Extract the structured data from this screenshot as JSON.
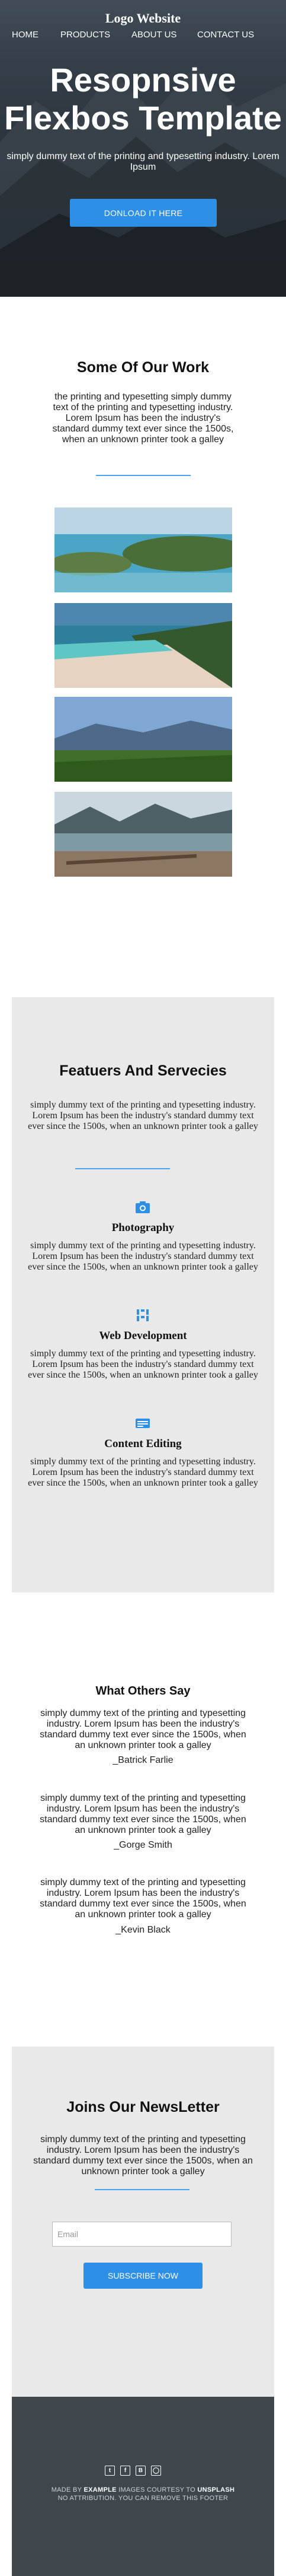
{
  "header": {
    "logo": "Logo Website",
    "nav": [
      "HOME",
      "PRODUCTS",
      "ABOUT US",
      "CONTACT US"
    ]
  },
  "hero": {
    "title_line1": "Resopnsive",
    "title_line2": "Flexbos Template",
    "tagline": "simply dummy text of the printing and typesetting industry. Lorem Ipsum",
    "button": "DONLOAD IT HERE"
  },
  "work": {
    "title": "Some Of Our Work",
    "description": "the printing and typesetting simply dummy text of the printing and typesetting industry. Lorem Ipsum has been the industry's standard dummy text ever since the 1500s, when an unknown printer took a galley",
    "photos": [
      "island-lake-photo",
      "tropical-beach-photo",
      "mountain-valley-photo",
      "driftwood-lake-photo"
    ]
  },
  "features": {
    "title": "Featuers And Servecies",
    "intro": "simply dummy text of the printing and typesetting industry. Lorem Ipsum has been the industry's standard dummy text ever since the 1500s, when an unknown printer took a galley",
    "items": [
      {
        "icon": "camera-icon",
        "title": "Photography",
        "text": "simply dummy text of the printing and typesetting industry. Lorem Ipsum has been the industry's standard dummy text ever since the 1500s, when an unknown printer took a galley"
      },
      {
        "icon": "code-icon",
        "title": "Web Development",
        "text": "simply dummy text of the printing and typesetting industry. Lorem Ipsum has been the industry's standard dummy text ever since the 1500s, when an unknown printer took a galley"
      },
      {
        "icon": "edit-icon",
        "title": "Content Editing",
        "text": "simply dummy text of the printing and typesetting industry. Lorem Ipsum has been the industry's standard dummy text ever since the 1500s, when an unknown printer took a galley"
      }
    ]
  },
  "testimonials": {
    "title": "What Others Say",
    "items": [
      {
        "quote": "simply dummy text of the printing and typesetting industry. Lorem Ipsum has been the industry's standard dummy text ever since the 1500s, when an unknown printer took a galley",
        "author": "_Batrick Farlie"
      },
      {
        "quote": "simply dummy text of the printing and typesetting industry. Lorem Ipsum has been the industry's standard dummy text ever since the 1500s, when an unknown printer took a galley",
        "author": "_Gorge Smith"
      },
      {
        "quote": "simply dummy text of the printing and typesetting industry. Lorem Ipsum has been the industry's standard dummy text ever since the 1500s, when an unknown printer took a galley",
        "author": "_Kevin Black"
      }
    ]
  },
  "newsletter": {
    "title": "Joins Our NewsLetter",
    "description": "simply dummy text of the printing and typesetting industry. Lorem Ipsum has been the industry's standard dummy text ever since the 1500s, when an unknown printer took a galley",
    "email_placeholder": "Email",
    "button": "SUBSCRIBE NOW"
  },
  "footer": {
    "social_icons": [
      "twitter-icon",
      "facebook-icon",
      "behance-icon",
      "instagram-icon"
    ],
    "credit_prefix": "MADE BY",
    "credit_brand": "EXAMPLE",
    "credit_mid": "IMAGES COURTESY TO",
    "credit_source": "UNSPLASH",
    "credit_line2": "NO ATTRIBUTION. YOU CAN REMOVE THIS FOOTER"
  },
  "colors": {
    "accent": "#2e8fe6",
    "panel": "#e9e9e9",
    "footer_bg": "#3f464c"
  }
}
